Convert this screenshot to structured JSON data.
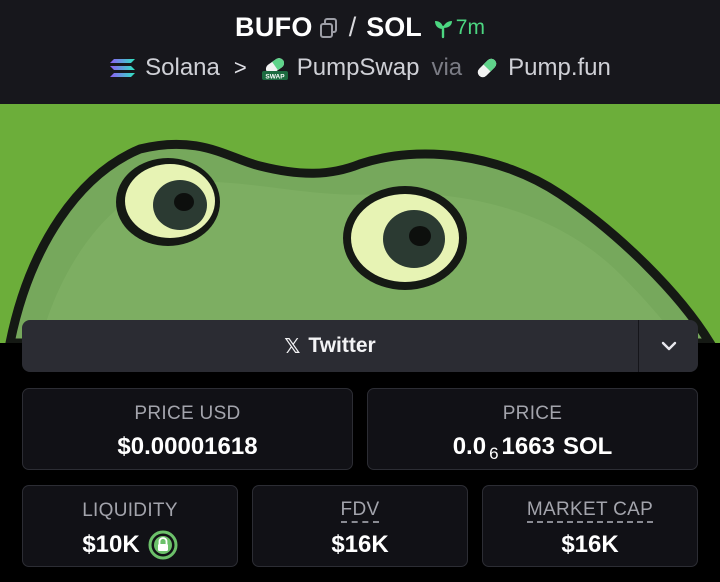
{
  "pair": {
    "base": "BUFO",
    "separator": "/",
    "quote": "SOL",
    "age": "7m"
  },
  "breadcrumb": {
    "chain": "Solana",
    "dex": "PumpSwap",
    "via": "via",
    "launchpad": "Pump.fun"
  },
  "icons": {
    "copy": "copy-icon",
    "sprout": "sprout-icon",
    "chain": "solana-icon",
    "dex": "pumpswap-icon",
    "launchpad": "pill-icon",
    "social": "x-icon",
    "expand": "chevron-down-icon",
    "lock": "lock-icon"
  },
  "socials": {
    "twitter_glyph": "𝕏",
    "twitter_label": "Twitter"
  },
  "stats": {
    "price_usd": {
      "label": "PRICE USD",
      "value": "$0.00001618"
    },
    "price": {
      "label": "PRICE",
      "prefix": "0.0",
      "zeros": "6",
      "digits": "1663",
      "unit": "SOL"
    },
    "liquidity": {
      "label": "LIQUIDITY",
      "value": "$10K"
    },
    "fdv": {
      "label": "FDV",
      "value": "$16K"
    },
    "market_cap": {
      "label": "MARKET CAP",
      "value": "$16K"
    }
  },
  "colors": {
    "accent_green": "#4cd681",
    "banner_green": "#6cae3a",
    "card_border": "#2c2d34",
    "background": "#111116"
  }
}
